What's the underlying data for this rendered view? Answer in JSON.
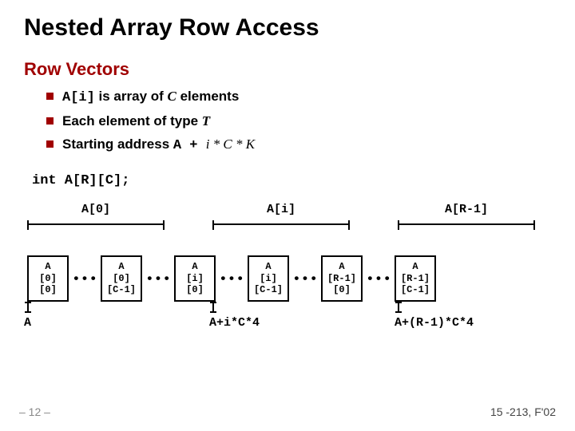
{
  "title": "Nested Array Row Access",
  "section": "Row Vectors",
  "bullets": {
    "b1_code": "A[i]",
    "b1_rest": " is array of ",
    "b1_C": "C",
    "b1_tail": " elements",
    "b2_pre": "Each element of type ",
    "b2_T": "T",
    "b3_pre": "Starting address ",
    "b3_code": "A + ",
    "b3_expr": " i * C * K"
  },
  "decl": "int A[R][C];",
  "groups": {
    "g0": "A[0]",
    "gi": "A[i]",
    "gR": "A[R-1]"
  },
  "boxes": {
    "c00a": "A",
    "c00b": "[0]",
    "c00c": "[0]",
    "c0Ca": "A",
    "c0Cb": "[0]",
    "c0Cc": "[C-1]",
    "ci0a": "A",
    "ci0b": "[i]",
    "ci0c": "[0]",
    "ciCa": "A",
    "ciCb": "[i]",
    "ciCc": "[C-1]",
    "cR0a": "A",
    "cR0b": "[R-1]",
    "cR0c": "[0]",
    "cRCa": "A",
    "cRCb": "[R-1]",
    "cRCc": "[C-1]"
  },
  "ellipsis": "• • •",
  "addrs": {
    "a0": "A",
    "ai": "A+i*C*4",
    "aR": "A+(R-1)*C*4"
  },
  "footer": {
    "left": "– 12 –",
    "right": "15 -213, F'02"
  }
}
